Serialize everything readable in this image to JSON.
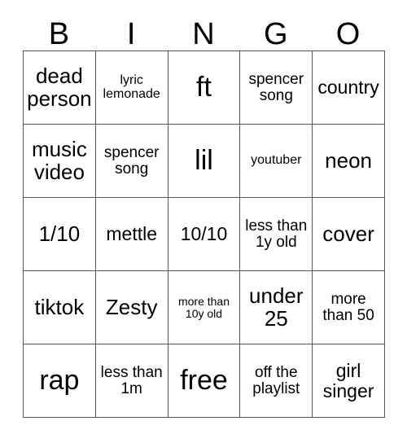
{
  "header": {
    "letters": [
      "B",
      "I",
      "N",
      "G",
      "O"
    ]
  },
  "grid": {
    "rows": [
      [
        {
          "text": "dead person",
          "size": "fs-xl"
        },
        {
          "text": "lyric lemonade",
          "size": "fs-sm"
        },
        {
          "text": "ft",
          "size": "fs-xxl"
        },
        {
          "text": "spencer song",
          "size": "fs-md"
        },
        {
          "text": "country",
          "size": "fs-lg"
        }
      ],
      [
        {
          "text": "music video",
          "size": "fs-xl"
        },
        {
          "text": "spencer song",
          "size": "fs-md"
        },
        {
          "text": "lil",
          "size": "fs-xxl"
        },
        {
          "text": "youtuber",
          "size": "fs-sm"
        },
        {
          "text": "neon",
          "size": "fs-xl"
        }
      ],
      [
        {
          "text": "1/10",
          "size": "fs-xl"
        },
        {
          "text": "mettle",
          "size": "fs-lg"
        },
        {
          "text": "10/10",
          "size": "fs-lg"
        },
        {
          "text": "less than 1y old",
          "size": "fs-md"
        },
        {
          "text": "cover",
          "size": "fs-xl"
        }
      ],
      [
        {
          "text": "tiktok",
          "size": "fs-xl"
        },
        {
          "text": "Zesty",
          "size": "fs-xl"
        },
        {
          "text": "more than 10y old",
          "size": "fs-xs"
        },
        {
          "text": "under 25",
          "size": "fs-xl"
        },
        {
          "text": "more than 50",
          "size": "fs-md"
        }
      ],
      [
        {
          "text": "rap",
          "size": "fs-xxl"
        },
        {
          "text": "less than 1m",
          "size": "fs-md"
        },
        {
          "text": "free",
          "size": "fs-xxl"
        },
        {
          "text": "off the playlist",
          "size": "fs-md"
        },
        {
          "text": "girl singer",
          "size": "fs-lg"
        }
      ]
    ]
  }
}
